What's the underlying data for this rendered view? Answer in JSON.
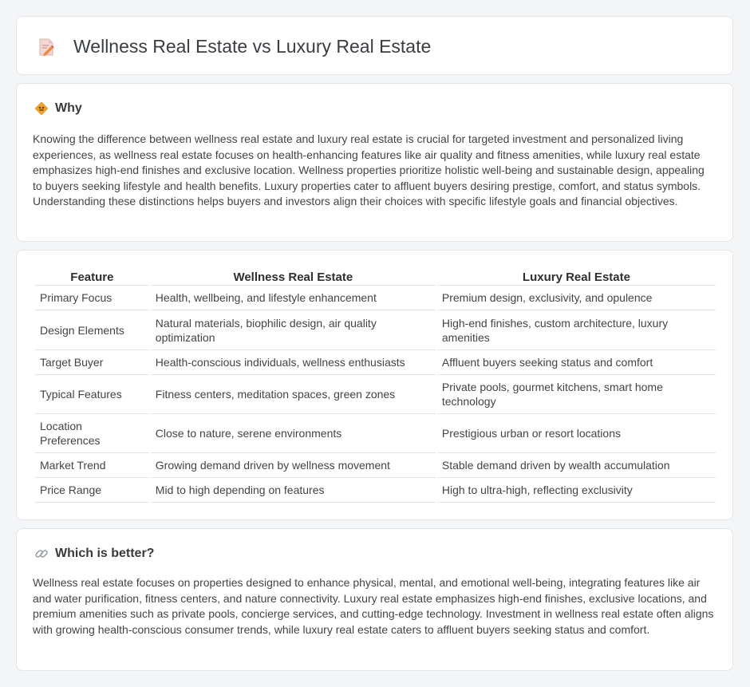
{
  "header": {
    "title": "Wellness Real Estate vs Luxury Real Estate",
    "icon": "document-pencil-icon"
  },
  "why": {
    "heading": "Why",
    "icon": "diamond-sign-icon",
    "text": "Knowing the difference between wellness real estate and luxury real estate is crucial for targeted investment and personalized living experiences, as wellness real estate focuses on health-enhancing features like air quality and fitness amenities, while luxury real estate emphasizes high-end finishes and exclusive location. Wellness properties prioritize holistic well-being and sustainable design, appealing to buyers seeking lifestyle and health benefits. Luxury properties cater to affluent buyers desiring prestige, comfort, and status symbols. Understanding these distinctions helps buyers and investors align their choices with specific lifestyle goals and financial objectives."
  },
  "comparison": {
    "headers": [
      "Feature",
      "Wellness Real Estate",
      "Luxury Real Estate"
    ],
    "rows": [
      {
        "feature": "Primary Focus",
        "wellness": "Health, wellbeing, and lifestyle enhancement",
        "luxury": "Premium design, exclusivity, and opulence"
      },
      {
        "feature": "Design Elements",
        "wellness": "Natural materials, biophilic design, air quality optimization",
        "luxury": "High-end finishes, custom architecture, luxury amenities"
      },
      {
        "feature": "Target Buyer",
        "wellness": "Health-conscious individuals, wellness enthusiasts",
        "luxury": "Affluent buyers seeking status and comfort"
      },
      {
        "feature": "Typical Features",
        "wellness": "Fitness centers, meditation spaces, green zones",
        "luxury": "Private pools, gourmet kitchens, smart home technology"
      },
      {
        "feature": "Location Preferences",
        "wellness": "Close to nature, serene environments",
        "luxury": "Prestigious urban or resort locations"
      },
      {
        "feature": "Market Trend",
        "wellness": "Growing demand driven by wellness movement",
        "luxury": "Stable demand driven by wealth accumulation"
      },
      {
        "feature": "Price Range",
        "wellness": "Mid to high depending on features",
        "luxury": "High to ultra-high, reflecting exclusivity"
      }
    ]
  },
  "better": {
    "heading": "Which is better?",
    "icon": "link-icon",
    "text": "Wellness real estate focuses on properties designed to enhance physical, mental, and emotional well-being, integrating features like air and water purification, fitness centers, and nature connectivity. Luxury real estate emphasizes high-end finishes, exclusive locations, and premium amenities such as private pools, concierge services, and cutting-edge technology. Investment in wellness real estate often aligns with growing health-conscious consumer trends, while luxury real estate caters to affluent buyers seeking status and comfort."
  }
}
